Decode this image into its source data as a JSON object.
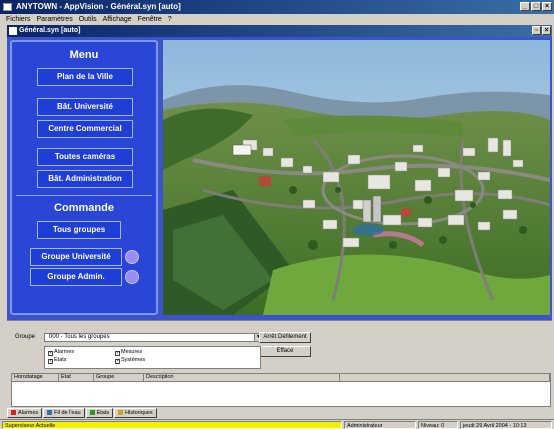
{
  "app": {
    "title": "ANYTOWN - AppVision - Général.syn [auto]"
  },
  "menubar": [
    "Fichiers",
    "Paramètres",
    "Outils",
    "Affichage",
    "Fenêtre",
    "?"
  ],
  "child_window": {
    "title": "Général.syn [auto]"
  },
  "menu_panel": {
    "menu_title": "Menu",
    "menu_buttons": [
      "Plan de la Ville",
      "Bât. Université",
      "Centre Commercial",
      "Toutes caméras",
      "Bât. Administration"
    ],
    "command_title": "Commande",
    "command_buttons": [
      "Tous groupes",
      "Groupe Université",
      "Groupe Admin."
    ]
  },
  "alarm_panel": {
    "group_label": "Groupe",
    "group_value": "000 - Tous les groupes",
    "acquit_button": "Arrêt Défilement",
    "clear_button": "Efface",
    "filters": [
      "Alarmes",
      "Etats",
      "Mesures",
      "Systèmes"
    ],
    "columns": [
      "Horodatage",
      "Etat",
      "Groupe",
      "Description"
    ]
  },
  "tabs": [
    "Alarmes",
    "Fil de l'eau",
    "Etats",
    "Historiques"
  ],
  "statusbar": {
    "left": "Superviseur Actuelle",
    "user": "Administrateur",
    "page": "Niveau: 0",
    "datetime": "jeudi 29 Avril 2004 - 10:13"
  },
  "colors": {
    "panel": "#2946d6",
    "button": "#1e3ed6",
    "indicator": "#9a8cf0",
    "titlebar": "#0a246a"
  }
}
